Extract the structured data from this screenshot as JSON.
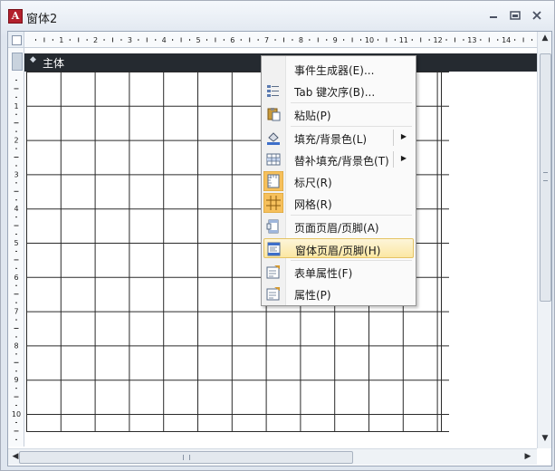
{
  "window": {
    "title": "窗体2",
    "app_icon_letter": "A",
    "controls": {
      "minimize": "▭",
      "restore": "⧉",
      "close": "✕"
    }
  },
  "rulers": {
    "horizontal_numbers": [
      "1",
      "2",
      "3",
      "4",
      "5",
      "6",
      "7",
      "8",
      "9",
      "10",
      "11",
      "12",
      "13",
      "14"
    ],
    "vertical_numbers": [
      "1",
      "2",
      "3",
      "4",
      "5",
      "6",
      "7",
      "8",
      "9",
      "10"
    ]
  },
  "section": {
    "label": "主体",
    "icon": "section-arrow-icon"
  },
  "context_menu": {
    "items": [
      {
        "label": "事件生成器(E)...",
        "icon": "none",
        "submenu": false
      },
      {
        "label": "Tab 键次序(B)...",
        "icon": "tab-order-icon",
        "submenu": false
      },
      {
        "label": "粘贴(P)",
        "icon": "paste-icon",
        "submenu": false
      },
      {
        "label": "填充/背景色(L)",
        "icon": "fill-color-icon",
        "submenu": true
      },
      {
        "label": "替补填充/背景色(T)",
        "icon": "alternate-fill-icon",
        "submenu": true
      },
      {
        "label": "标尺(R)",
        "icon": "ruler-icon",
        "submenu": false,
        "checked": true
      },
      {
        "label": "网格(R)",
        "icon": "grid-icon",
        "submenu": false,
        "checked": true
      },
      {
        "label": "页面页眉/页脚(A)",
        "icon": "page-header-footer-icon",
        "submenu": false
      },
      {
        "label": "窗体页眉/页脚(H)",
        "icon": "form-header-footer-icon",
        "submenu": false,
        "highlighted": true
      },
      {
        "label": "表单属性(F)",
        "icon": "form-properties-icon",
        "submenu": false
      },
      {
        "label": "属性(P)",
        "icon": "properties-icon",
        "submenu": false
      }
    ]
  },
  "colors": {
    "section_bar": "#252a30",
    "highlight": "#fbe7a3",
    "checked_icon_bg": "#f6c05c",
    "grid_line": "#2a2a2a"
  }
}
